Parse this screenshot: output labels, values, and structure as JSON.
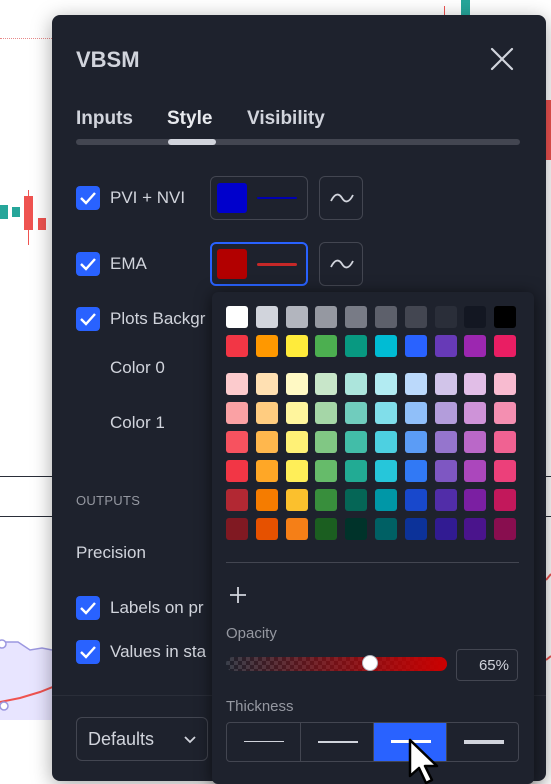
{
  "dialog": {
    "title": "VBSM",
    "tabs": [
      {
        "label": "Inputs"
      },
      {
        "label": "Style"
      },
      {
        "label": "Visibility"
      }
    ],
    "active_tab": "Style",
    "rows": [
      {
        "label": "PVI + NVI",
        "checked": true,
        "color": "#0000cc"
      },
      {
        "label": "EMA",
        "checked": true,
        "color": "#b20000"
      },
      {
        "label": "Plots Backgr",
        "checked": true
      },
      {
        "label": "Color 0"
      },
      {
        "label": "Color 1"
      }
    ],
    "outputs_section": "OUTPUTS",
    "precision_label": "Precision",
    "labels_on_price": "Labels on pr",
    "values_in_status": "Values in sta",
    "defaults_button": "Defaults"
  },
  "picker": {
    "palette": [
      [
        "#ffffff",
        "#d1d4dc",
        "#b2b5be",
        "#9598a1",
        "#787b86",
        "#5d606b",
        "#434651",
        "#2a2e39",
        "#131722",
        "#000000"
      ],
      [
        "#f23645",
        "#ff9800",
        "#ffeb3b",
        "#4caf50",
        "#089981",
        "#00bcd4",
        "#2962ff",
        "#673ab7",
        "#9c27b0",
        "#e91e63"
      ],
      [
        "#fccbcd",
        "#ffe0b2",
        "#fff9c4",
        "#c8e6c9",
        "#ace5dc",
        "#b2ebf2",
        "#bbd9fb",
        "#d1c4e9",
        "#e1bee7",
        "#f8bbd0"
      ],
      [
        "#faa1a4",
        "#ffcc80",
        "#fff59d",
        "#a5d6a7",
        "#70ccbd",
        "#80deea",
        "#90bff9",
        "#b39ddb",
        "#ce93d8",
        "#f48fb1"
      ],
      [
        "#f7525f",
        "#ffb74d",
        "#fff176",
        "#81c784",
        "#42bda8",
        "#4dd0e1",
        "#5b9cf6",
        "#9575cd",
        "#ba68c8",
        "#f06292"
      ],
      [
        "#f23645",
        "#ffa726",
        "#ffee58",
        "#66bb6a",
        "#22ab94",
        "#26c6da",
        "#3179f5",
        "#7e57c2",
        "#ab47bc",
        "#ec407a"
      ],
      [
        "#b22833",
        "#f57c00",
        "#fbc02d",
        "#388e3c",
        "#056656",
        "#0097a7",
        "#1848cc",
        "#512da8",
        "#7b1fa2",
        "#c2185b"
      ],
      [
        "#801922",
        "#e65100",
        "#f57f17",
        "#1b5e20",
        "#00332a",
        "#006064",
        "#0c3299",
        "#311b92",
        "#4a148c",
        "#880e4f"
      ]
    ],
    "add_custom": "+",
    "opacity_label": "Opacity",
    "opacity_value": "65%",
    "opacity_fraction": 0.65,
    "thickness_label": "Thickness",
    "thickness_options": [
      1,
      2,
      3,
      4
    ],
    "thickness_selected": 3
  },
  "colors": {
    "accent": "#2962ff",
    "panel": "#1e222d",
    "text": "#d1d4dc"
  },
  "icons": {
    "close": "close-icon",
    "line_style": "line-style-icon",
    "check": "check-icon",
    "chevron": "chevron-down-icon",
    "add": "plus-icon",
    "cursor": "mouse-cursor-icon"
  }
}
